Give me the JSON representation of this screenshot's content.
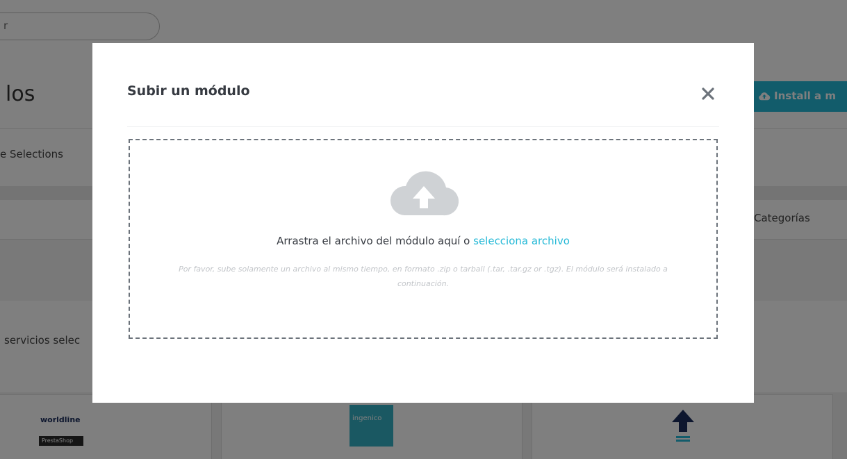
{
  "background": {
    "search": {
      "placeholder": "r"
    },
    "page_title": "los",
    "install_button_label": "Install a m",
    "tab_selections": "e Selections",
    "categories_label": "Categorías",
    "services_text": "servicios selec",
    "cards": [
      {
        "logo": "worldline",
        "sublogo": "PrestaShop"
      },
      {
        "logo": "ingenico"
      },
      {
        "logo": "upload-arrow"
      }
    ]
  },
  "modal": {
    "title": "Subir un módulo",
    "close_icon": "close-icon",
    "dropzone": {
      "icon": "cloud-upload-icon",
      "text": "Arrastra el archivo del módulo aquí o",
      "link": "selecciona archivo",
      "hint": "Por favor, sube solamente un archivo al mismo tiempo, en formato .zip o tarball (.tar, .tar.gz or .tgz). El módulo será instalado a continuación."
    }
  },
  "colors": {
    "accent": "#25b9d7",
    "overlay": "rgba(0,0,0,0.5)",
    "title_text": "#363a41"
  }
}
